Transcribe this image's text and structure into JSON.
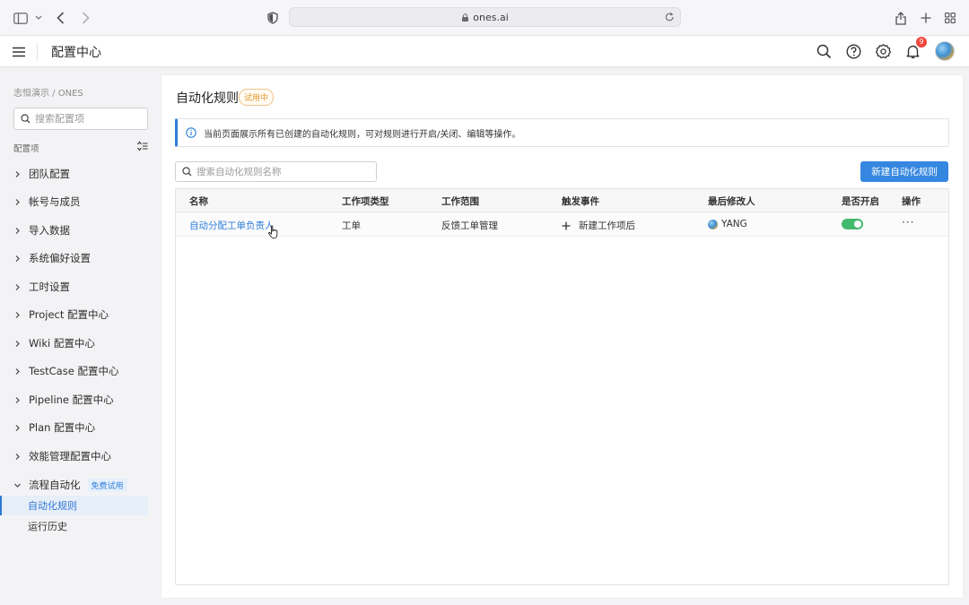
{
  "browser": {
    "url": "ones.ai"
  },
  "header": {
    "title": "配置中心",
    "notification_count": "9"
  },
  "sidebar": {
    "breadcrumb": "志恒演示 / ONES",
    "search_placeholder": "搜索配置项",
    "section_label": "配置项",
    "items": [
      {
        "label": "团队配置"
      },
      {
        "label": "帐号与成员"
      },
      {
        "label": "导入数据"
      },
      {
        "label": "系统偏好设置"
      },
      {
        "label": "工时设置"
      },
      {
        "label": "Project 配置中心"
      },
      {
        "label": "Wiki 配置中心"
      },
      {
        "label": "TestCase 配置中心"
      },
      {
        "label": "Pipeline 配置中心"
      },
      {
        "label": "Plan 配置中心"
      },
      {
        "label": "效能管理配置中心"
      },
      {
        "label": "流程自动化",
        "tag": "免费试用"
      }
    ],
    "sub_items": [
      {
        "label": "自动化规则",
        "active": true
      },
      {
        "label": "运行历史",
        "active": false
      }
    ]
  },
  "main": {
    "title": "自动化规则",
    "trial_tag": "试用中",
    "info": "当前页面展示所有已创建的自动化规则，可对规则进行开启/关闭、编辑等操作。",
    "search_placeholder": "搜索自动化规则名称",
    "new_button": "新建自动化规则",
    "columns": [
      "名称",
      "工作项类型",
      "工作范围",
      "触发事件",
      "最后修改人",
      "是否开启",
      "操作"
    ],
    "rows": [
      {
        "name": "自动分配工单负责人",
        "type": "工单",
        "scope": "反馈工单管理",
        "trigger": "新建工作项后",
        "modifier": "YANG",
        "enabled": true,
        "action": "···"
      }
    ]
  },
  "colors": {
    "accent": "#3587e0",
    "toggle_on": "#43b96d",
    "badge": "#f0453b",
    "trial": "#e19a2c"
  }
}
